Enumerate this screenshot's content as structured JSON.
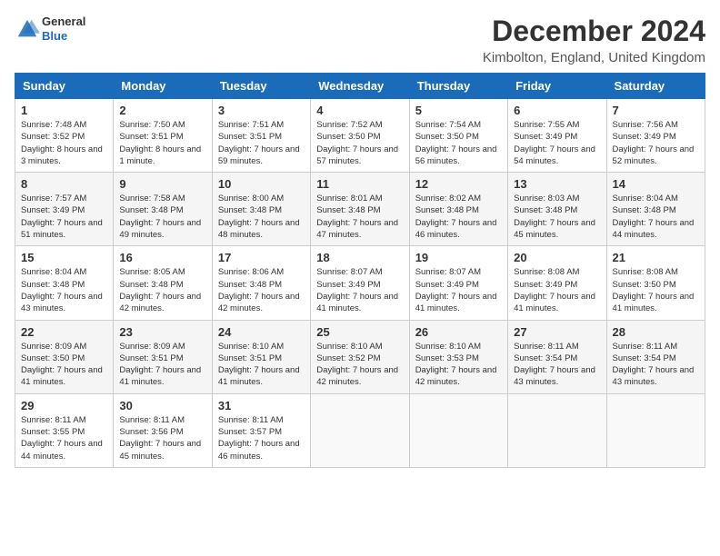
{
  "logo": {
    "general": "General",
    "blue": "Blue"
  },
  "title": "December 2024",
  "location": "Kimbolton, England, United Kingdom",
  "weekdays": [
    "Sunday",
    "Monday",
    "Tuesday",
    "Wednesday",
    "Thursday",
    "Friday",
    "Saturday"
  ],
  "weeks": [
    [
      {
        "day": "1",
        "sunrise": "7:48 AM",
        "sunset": "3:52 PM",
        "daylight": "8 hours and 3 minutes."
      },
      {
        "day": "2",
        "sunrise": "7:50 AM",
        "sunset": "3:51 PM",
        "daylight": "8 hours and 1 minute."
      },
      {
        "day": "3",
        "sunrise": "7:51 AM",
        "sunset": "3:51 PM",
        "daylight": "7 hours and 59 minutes."
      },
      {
        "day": "4",
        "sunrise": "7:52 AM",
        "sunset": "3:50 PM",
        "daylight": "7 hours and 57 minutes."
      },
      {
        "day": "5",
        "sunrise": "7:54 AM",
        "sunset": "3:50 PM",
        "daylight": "7 hours and 56 minutes."
      },
      {
        "day": "6",
        "sunrise": "7:55 AM",
        "sunset": "3:49 PM",
        "daylight": "7 hours and 54 minutes."
      },
      {
        "day": "7",
        "sunrise": "7:56 AM",
        "sunset": "3:49 PM",
        "daylight": "7 hours and 52 minutes."
      }
    ],
    [
      {
        "day": "8",
        "sunrise": "7:57 AM",
        "sunset": "3:49 PM",
        "daylight": "7 hours and 51 minutes."
      },
      {
        "day": "9",
        "sunrise": "7:58 AM",
        "sunset": "3:48 PM",
        "daylight": "7 hours and 49 minutes."
      },
      {
        "day": "10",
        "sunrise": "8:00 AM",
        "sunset": "3:48 PM",
        "daylight": "7 hours and 48 minutes."
      },
      {
        "day": "11",
        "sunrise": "8:01 AM",
        "sunset": "3:48 PM",
        "daylight": "7 hours and 47 minutes."
      },
      {
        "day": "12",
        "sunrise": "8:02 AM",
        "sunset": "3:48 PM",
        "daylight": "7 hours and 46 minutes."
      },
      {
        "day": "13",
        "sunrise": "8:03 AM",
        "sunset": "3:48 PM",
        "daylight": "7 hours and 45 minutes."
      },
      {
        "day": "14",
        "sunrise": "8:04 AM",
        "sunset": "3:48 PM",
        "daylight": "7 hours and 44 minutes."
      }
    ],
    [
      {
        "day": "15",
        "sunrise": "8:04 AM",
        "sunset": "3:48 PM",
        "daylight": "7 hours and 43 minutes."
      },
      {
        "day": "16",
        "sunrise": "8:05 AM",
        "sunset": "3:48 PM",
        "daylight": "7 hours and 42 minutes."
      },
      {
        "day": "17",
        "sunrise": "8:06 AM",
        "sunset": "3:48 PM",
        "daylight": "7 hours and 42 minutes."
      },
      {
        "day": "18",
        "sunrise": "8:07 AM",
        "sunset": "3:49 PM",
        "daylight": "7 hours and 41 minutes."
      },
      {
        "day": "19",
        "sunrise": "8:07 AM",
        "sunset": "3:49 PM",
        "daylight": "7 hours and 41 minutes."
      },
      {
        "day": "20",
        "sunrise": "8:08 AM",
        "sunset": "3:49 PM",
        "daylight": "7 hours and 41 minutes."
      },
      {
        "day": "21",
        "sunrise": "8:08 AM",
        "sunset": "3:50 PM",
        "daylight": "7 hours and 41 minutes."
      }
    ],
    [
      {
        "day": "22",
        "sunrise": "8:09 AM",
        "sunset": "3:50 PM",
        "daylight": "7 hours and 41 minutes."
      },
      {
        "day": "23",
        "sunrise": "8:09 AM",
        "sunset": "3:51 PM",
        "daylight": "7 hours and 41 minutes."
      },
      {
        "day": "24",
        "sunrise": "8:10 AM",
        "sunset": "3:51 PM",
        "daylight": "7 hours and 41 minutes."
      },
      {
        "day": "25",
        "sunrise": "8:10 AM",
        "sunset": "3:52 PM",
        "daylight": "7 hours and 42 minutes."
      },
      {
        "day": "26",
        "sunrise": "8:10 AM",
        "sunset": "3:53 PM",
        "daylight": "7 hours and 42 minutes."
      },
      {
        "day": "27",
        "sunrise": "8:11 AM",
        "sunset": "3:54 PM",
        "daylight": "7 hours and 43 minutes."
      },
      {
        "day": "28",
        "sunrise": "8:11 AM",
        "sunset": "3:54 PM",
        "daylight": "7 hours and 43 minutes."
      }
    ],
    [
      {
        "day": "29",
        "sunrise": "8:11 AM",
        "sunset": "3:55 PM",
        "daylight": "7 hours and 44 minutes."
      },
      {
        "day": "30",
        "sunrise": "8:11 AM",
        "sunset": "3:56 PM",
        "daylight": "7 hours and 45 minutes."
      },
      {
        "day": "31",
        "sunrise": "8:11 AM",
        "sunset": "3:57 PM",
        "daylight": "7 hours and 46 minutes."
      },
      null,
      null,
      null,
      null
    ]
  ]
}
